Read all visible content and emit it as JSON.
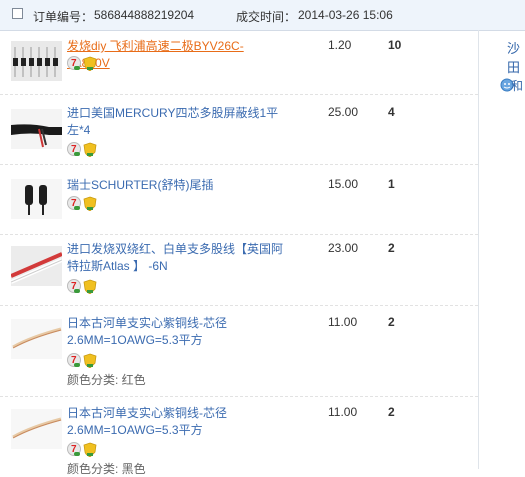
{
  "header": {
    "order_label": "订单编号：",
    "order_number": "586844888219204",
    "deal_time_label": "成交时间：",
    "deal_time": "2014-03-26 15:06"
  },
  "right_panel": {
    "seller_name": "沙田",
    "wangwang_label": "和"
  },
  "items": [
    {
      "title": "发烧diy 飞利浦高速二极BYV26C- 3A800V",
      "price": "1.20",
      "qty": "10",
      "attr": ""
    },
    {
      "title": "进口美国MERCURY四芯多股屏蔽线1平左*4",
      "price": "25.00",
      "qty": "4",
      "attr": ""
    },
    {
      "title": "瑞士SCHURTER(舒特)尾插",
      "price": "15.00",
      "qty": "1",
      "attr": ""
    },
    {
      "title": "进口发烧双绕红、白单支多股线【英国阿特拉斯Atlas 】 -6N",
      "price": "23.00",
      "qty": "2",
      "attr": ""
    },
    {
      "title": "日本古河单支实心紫铜线-芯径2.6MM=1OAWG=5.3平方",
      "price": "11.00",
      "qty": "2",
      "attr": "颜色分类: 红色"
    },
    {
      "title": "日本古河单支实心紫铜线-芯径2.6MM=1OAWG=5.3平方",
      "price": "11.00",
      "qty": "2",
      "attr": "颜色分类: 黑色"
    }
  ]
}
